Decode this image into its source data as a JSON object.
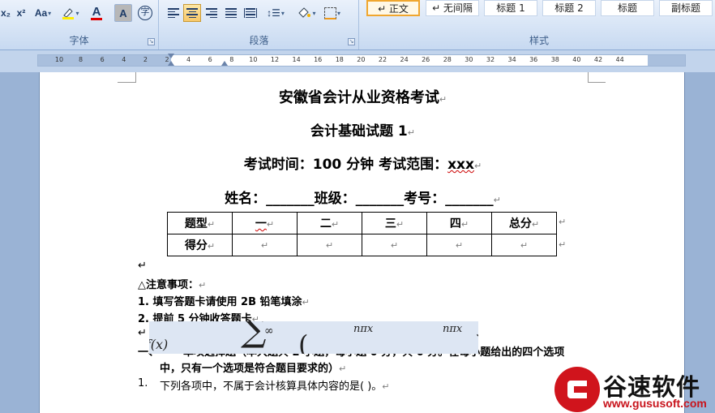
{
  "ribbon": {
    "font_group": {
      "label": "字体",
      "buttons": [
        "x₂",
        "x²",
        "Aa"
      ],
      "highlight_icon": "highlighter-icon",
      "font_color_label": "A",
      "char_shading_label": "A",
      "enclose_label": "字"
    },
    "paragraph_group": {
      "label": "段落"
    },
    "styles_group": {
      "label": "样式",
      "items": [
        "↵ 正文",
        "↵ 无间隔",
        "标题 1",
        "标题 2",
        "标题",
        "副标题"
      ]
    }
  },
  "ruler": {
    "ticks": [
      "10",
      "8",
      "6",
      "4",
      "2",
      "2",
      "4",
      "6",
      "8",
      "10",
      "12",
      "14",
      "16",
      "18",
      "20",
      "22",
      "24",
      "26",
      "28",
      "30",
      "32",
      "34",
      "36",
      "38",
      "40",
      "42",
      "44"
    ]
  },
  "document": {
    "title1": "安徽省会计从业资格考试",
    "title2": "会计基础试题 1",
    "info_prefix": "考试时间：100 分钟  考试范围：",
    "info_range": "xxx",
    "blanks": "姓名：_______班级：_______考号：_______",
    "table": {
      "header": [
        "题型",
        "一",
        "二",
        "三",
        "四",
        "总分"
      ],
      "row2_label": "得分"
    },
    "notice_title": "△注意事项：",
    "notice_1": "1. 填写答题卡请使用 2B 铅笔填涂",
    "notice_2": "2. 提前 5 分钟收答题卡",
    "section_num": "一、",
    "section_text_1": "单项选择题（本大题共 2 小题，每小题 0 分，共 0 分。在每小题给出的四个选项",
    "section_text_2": "中，只有一个选项是符合题目要求的）",
    "q1_num": "1.",
    "q1_text": "下列各项中，不属于会计核算具体内容的是(      )。"
  },
  "watermark": {
    "brand": "谷速软件",
    "url": "www.gususoft.com"
  },
  "colors": {
    "accent_red": "#d0141c",
    "ribbon_blue": "#d5e3f5"
  }
}
